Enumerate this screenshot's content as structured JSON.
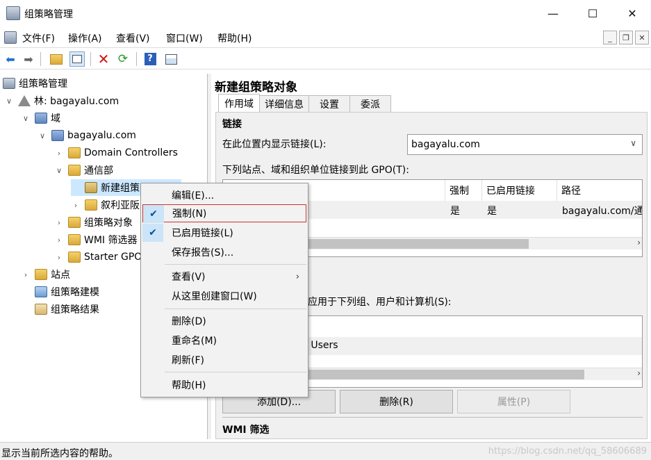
{
  "window": {
    "title": "组策略管理",
    "minimize": "—",
    "maximize": "☐",
    "close": "✕"
  },
  "menu": {
    "items": [
      "文件(F)",
      "操作(A)",
      "查看(V)",
      "窗口(W)",
      "帮助(H)"
    ],
    "mdi_min": "_",
    "mdi_restore": "❐",
    "mdi_close": "✕"
  },
  "toolbar": {
    "icons": [
      "back-icon",
      "forward-icon",
      "up-folder-icon",
      "show-hide-tree-icon",
      "delete-icon",
      "refresh-icon",
      "help-icon",
      "properties-icon"
    ]
  },
  "tree": {
    "root": "组策略管理",
    "forest": "林: bagayalu.com",
    "domains": "域",
    "domain": "bagayalu.com",
    "dc": "Domain Controllers",
    "ou": "通信部",
    "gpo_new": "新建组策",
    "gpo_other": "叙利亚阪",
    "gpo_objects": "组策略对象",
    "wmi": "WMI 筛选器",
    "starter": "Starter GPO",
    "sites": "站点",
    "modeling": "组策略建模",
    "results": "组策略结果"
  },
  "details": {
    "heading": "新建组策略对象",
    "tabs": [
      "作用域",
      "详细信息",
      "设置",
      "委派"
    ],
    "links_title": "链接",
    "display_links_label": "在此位置内显示链接(L):",
    "location_value": "bagayalu.com",
    "linked_label": "下列站点、域和组织单位链接到此 GPO(T):",
    "links_table": {
      "columns": [
        "强制",
        "已启用链接",
        "路径"
      ],
      "rows": [
        {
          "enforced": "是",
          "enabled": "是",
          "path": "bagayalu.com/通"
        }
      ]
    },
    "security_label_partial": "只应用于下列组、用户和计算机(S):",
    "security_row_partial": "l Users",
    "buttons": {
      "add": "添加(D)...",
      "remove": "删除(R)",
      "properties": "属性(P)"
    },
    "wmi_title": "WMI 筛选"
  },
  "context_menu": {
    "edit": "编辑(E)...",
    "enforce": "强制(N)",
    "link_enabled": "已启用链接(L)",
    "save_report": "保存报告(S)...",
    "view": "查看(V)",
    "new_window": "从这里创建窗口(W)",
    "delete": "删除(D)",
    "rename": "重命名(M)",
    "refresh": "刷新(F)",
    "help": "帮助(H)"
  },
  "status": {
    "text": "显示当前所选内容的帮助。"
  },
  "watermark": "https://blog.csdn.net/qq_58606689"
}
